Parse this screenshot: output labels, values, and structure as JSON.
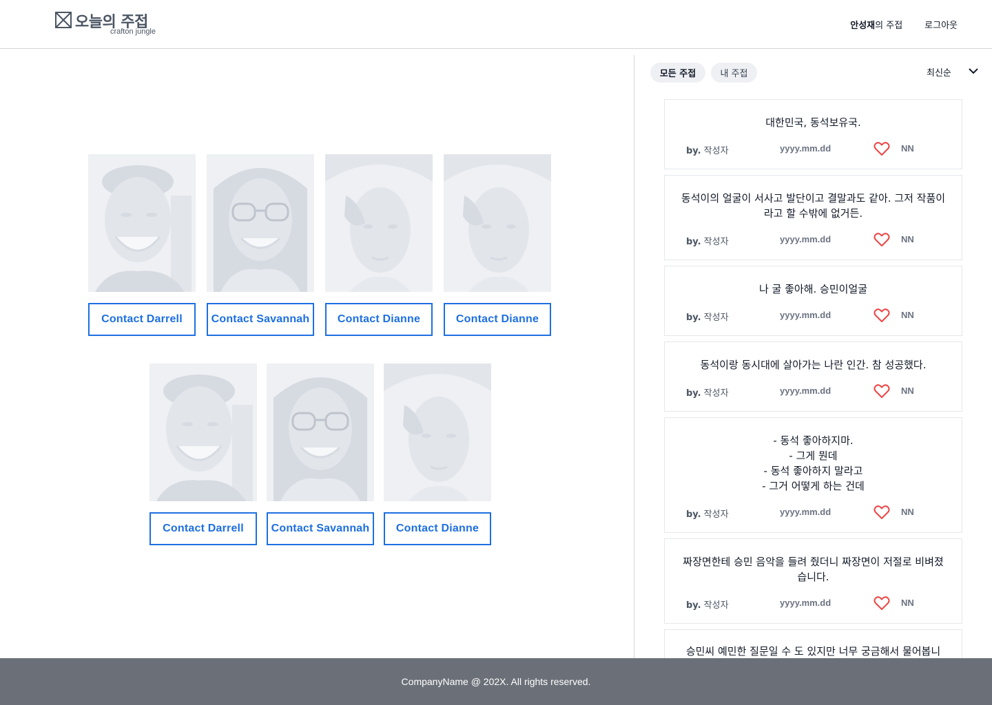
{
  "header": {
    "logo_title": "오늘의 주접",
    "logo_sub": "crafton jungle",
    "user_name": "안성재",
    "user_suffix": "의 주접",
    "logout": "로그아웃"
  },
  "grid": {
    "row1": [
      "Contact Darrell",
      "Contact Savannah",
      "Contact Dianne",
      "Contact Dianne"
    ],
    "row2": [
      "Contact Darrell",
      "Contact Savannah",
      "Contact Dianne"
    ]
  },
  "sidebar": {
    "tabs": [
      "모든 주접",
      "내 주접"
    ],
    "sort_label": "최신순",
    "posts": [
      {
        "lines": [
          "대한민국, 동석보유국."
        ],
        "by": "by.",
        "author": "작성자",
        "date": "yyyy.mm.dd",
        "likes": "NN"
      },
      {
        "lines": [
          "동석이의 얼굴이 서사고 발단이고 결말과도 같아. 그저 작품이",
          "라고 할 수밖에 없거든."
        ],
        "by": "by.",
        "author": "작성자",
        "date": "yyyy.mm.dd",
        "likes": "NN"
      },
      {
        "lines": [
          "나 굴 좋아해. 승민이얼굴"
        ],
        "by": "by.",
        "author": "작성자",
        "date": "yyyy.mm.dd",
        "likes": "NN"
      },
      {
        "lines": [
          "동석이랑 동시대에 살아가는 나란 인간. 참 성공했다."
        ],
        "by": "by.",
        "author": "작성자",
        "date": "yyyy.mm.dd",
        "likes": "NN"
      },
      {
        "lines": [
          "- 동석 좋아하지마.",
          "- 그게 뭔데",
          "- 동석 좋아하지 말라고",
          "- 그거 어떻게 하는 건데"
        ],
        "by": "by.",
        "author": "작성자",
        "date": "yyyy.mm.dd",
        "likes": "NN"
      },
      {
        "lines": [
          "짜장면한테 승민 음악을 들려 줬더니 짜장면이 저절로 비벼졌",
          "습니다."
        ],
        "by": "by.",
        "author": "작성자",
        "date": "yyyy.mm.dd",
        "likes": "NN"
      },
      {
        "lines": [
          "승민씨 예민한 질문일 수 도 있지만 너무 궁금해서 물어봅니"
        ],
        "by": "",
        "author": "",
        "date": "",
        "likes": ""
      }
    ]
  },
  "footer": {
    "text": "CompanyName @ 202X. All rights reserved."
  },
  "colors": {
    "accent": "#1d6fe0",
    "heart": "#ef4444",
    "footer_bg": "#6b7078"
  }
}
